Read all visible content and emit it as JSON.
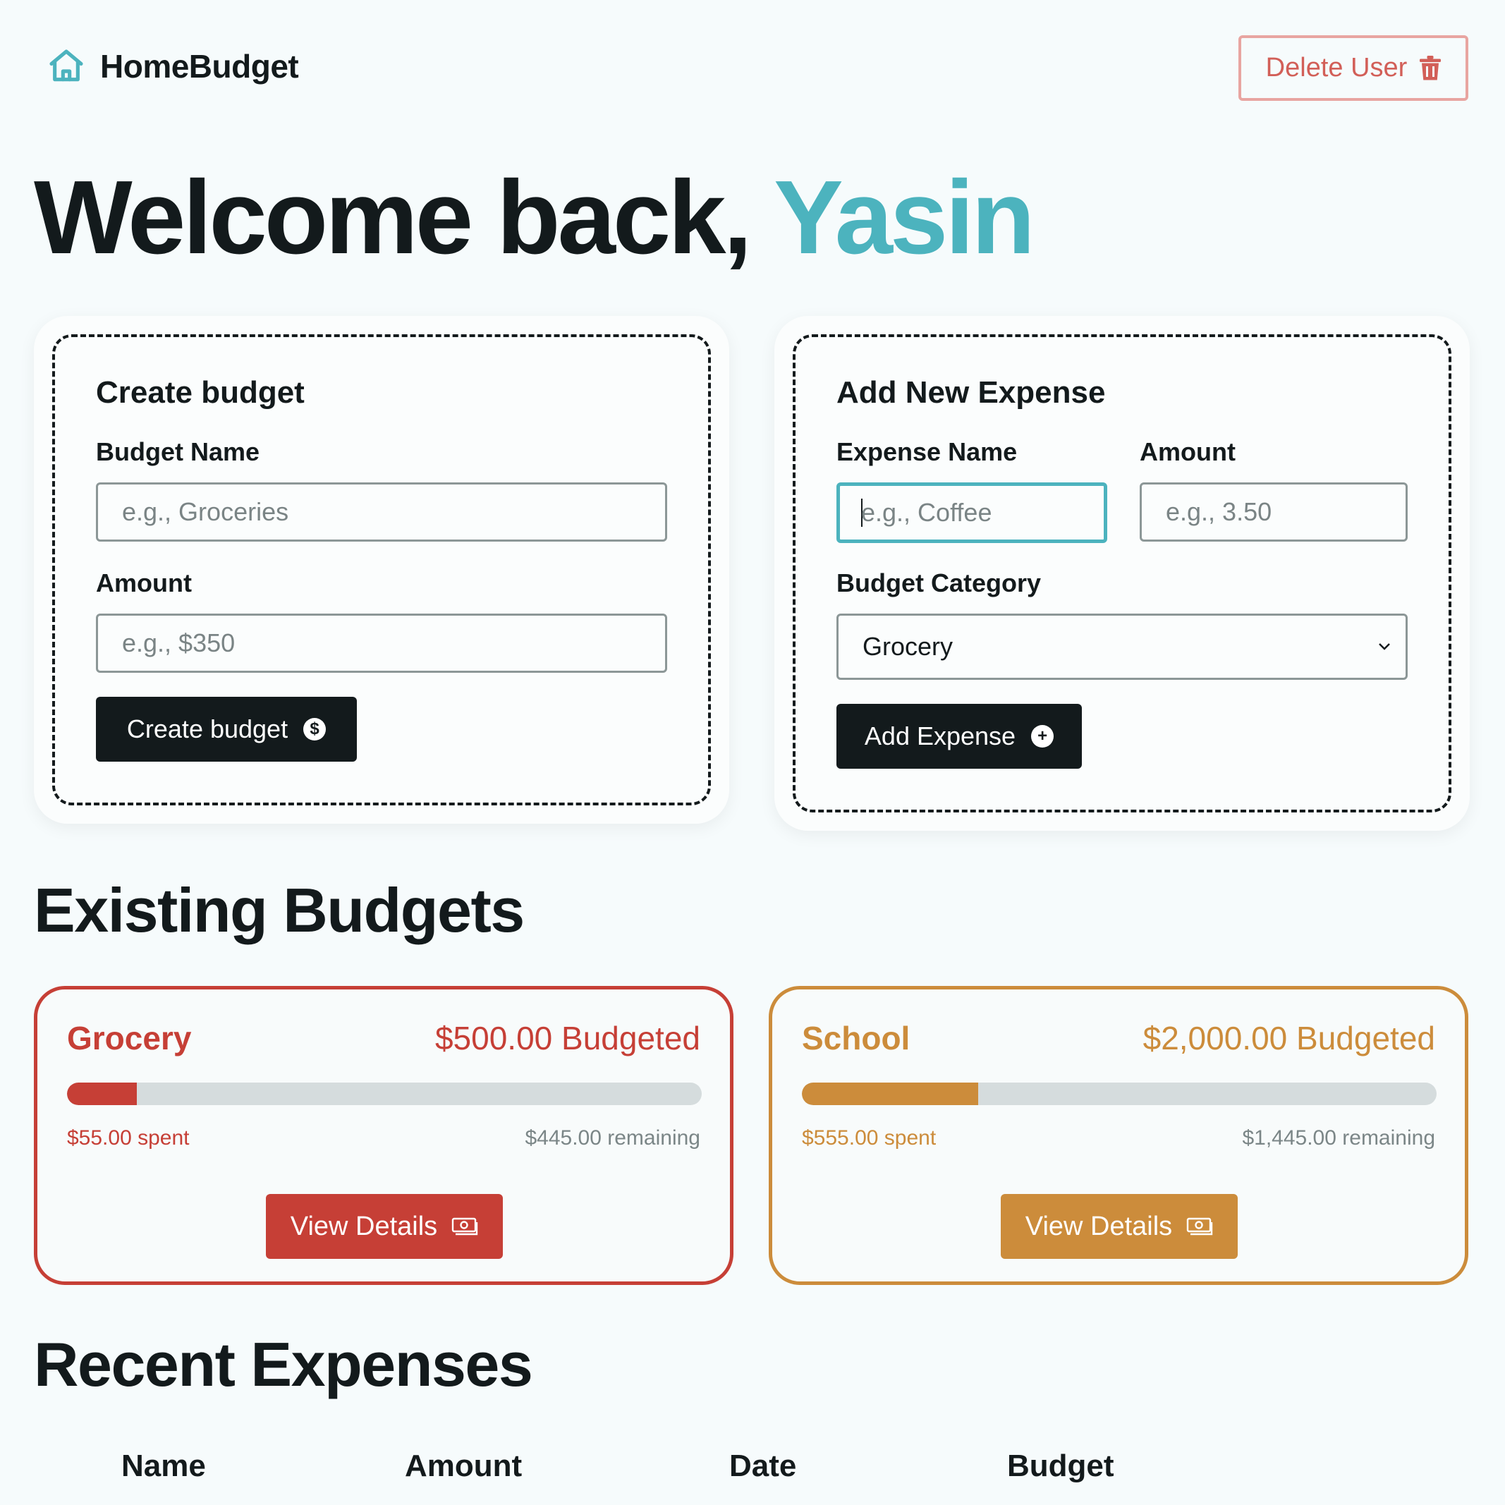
{
  "app": {
    "name": "HomeBudget",
    "accent": "#4cb3be"
  },
  "header": {
    "delete_user_label": "Delete User"
  },
  "welcome": {
    "prefix": "Welcome back,",
    "user_name": "Yasin"
  },
  "create_budget": {
    "title": "Create budget",
    "name_label": "Budget Name",
    "name_placeholder": "e.g., Groceries",
    "amount_label": "Amount",
    "amount_placeholder": "e.g., $350",
    "button_label": "Create budget",
    "button_icon": "dollar-circle-icon"
  },
  "add_expense": {
    "title": "Add New Expense",
    "name_label": "Expense Name",
    "name_placeholder": "e.g., Coffee",
    "amount_label": "Amount",
    "amount_placeholder": "e.g., 3.50",
    "category_label": "Budget Category",
    "category_selected": "Grocery",
    "button_label": "Add Expense",
    "button_icon": "plus-circle-icon"
  },
  "existing_budgets": {
    "title": "Existing Budgets",
    "items": [
      {
        "name": "Grocery",
        "budgeted": "$500.00 Budgeted",
        "spent": "$55.00 spent",
        "remaining": "$445.00 remaining",
        "progress": 0.11,
        "color": "#c63f36",
        "button_label": "View Details"
      },
      {
        "name": "School",
        "budgeted": "$2,000.00 Budgeted",
        "spent": "$555.00 spent",
        "remaining": "$1,445.00 remaining",
        "progress": 0.2775,
        "color": "#cc8c3b",
        "button_label": "View Details"
      }
    ]
  },
  "recent_expenses": {
    "title": "Recent Expenses",
    "columns": [
      "Name",
      "Amount",
      "Date",
      "Budget"
    ]
  }
}
